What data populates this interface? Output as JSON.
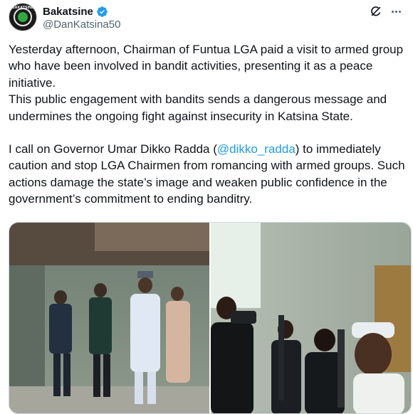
{
  "author": {
    "display_name": "Bakatsine",
    "handle": "@DanKatsina50",
    "avatar_text": "BAKATSINE",
    "verified": true
  },
  "tweet": {
    "para1": "Yesterday afternoon, Chairman of Funtua LGA paid a visit to armed group who have been involved in bandit activities, presenting it as a peace initiative.",
    "para2": "This public engagement with bandits sends a dangerous message and undermines the ongoing fight against insecurity in Katsina State.",
    "para3_before": "I call on Governor Umar Dikko Radda (",
    "mention": "@dikko_radda",
    "para3_after": ") to immediately caution and stop LGA Chairmen from romancing with armed groups. Such actions damage the state’s image and weaken public confidence in the government’s commitment to ending banditry."
  },
  "media": {
    "count": 2
  },
  "colors": {
    "text": "#0f1419",
    "secondary": "#536471",
    "link": "#1d9bf0",
    "verified": "#1d9bf0"
  },
  "icons": [
    "verified-badge-icon",
    "grok-icon",
    "more-options-icon"
  ]
}
